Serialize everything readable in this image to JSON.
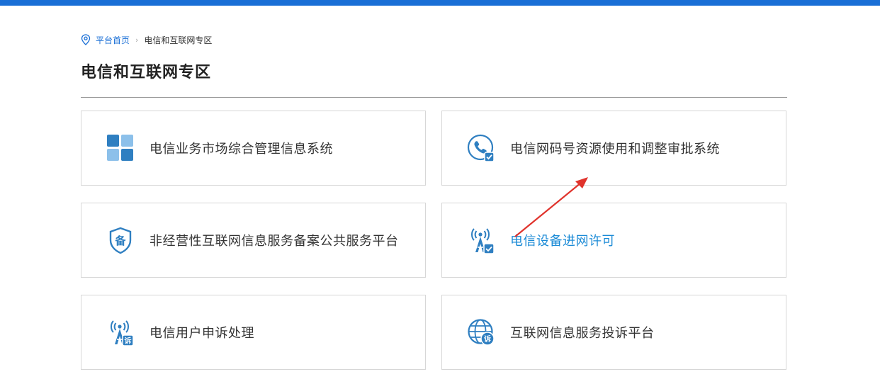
{
  "breadcrumb": {
    "home": "平台首页",
    "separator": "›",
    "current": "电信和互联网专区"
  },
  "page": {
    "title": "电信和互联网专区"
  },
  "cards": [
    {
      "label": "电信业务市场综合管理信息系统",
      "icon": "grid-icon"
    },
    {
      "label": "电信网码号资源使用和调整审批系统",
      "icon": "phone-icon"
    },
    {
      "label": "非经营性互联网信息服务备案公共服务平台",
      "icon": "shield-icon",
      "icon_text": "备"
    },
    {
      "label": "电信设备进网许可",
      "icon": "signal-tower-icon",
      "active": true
    },
    {
      "label": "电信用户申诉处理",
      "icon": "signal-tower-icon",
      "icon_text": "诉"
    },
    {
      "label": "互联网信息服务投诉平台",
      "icon": "globe-icon",
      "icon_text": "诉"
    }
  ],
  "colors": {
    "accent": "#1a6fd6",
    "icon": "#2f7fc1",
    "icon_light": "#8cc0ea",
    "annotation": "#e0332c"
  }
}
